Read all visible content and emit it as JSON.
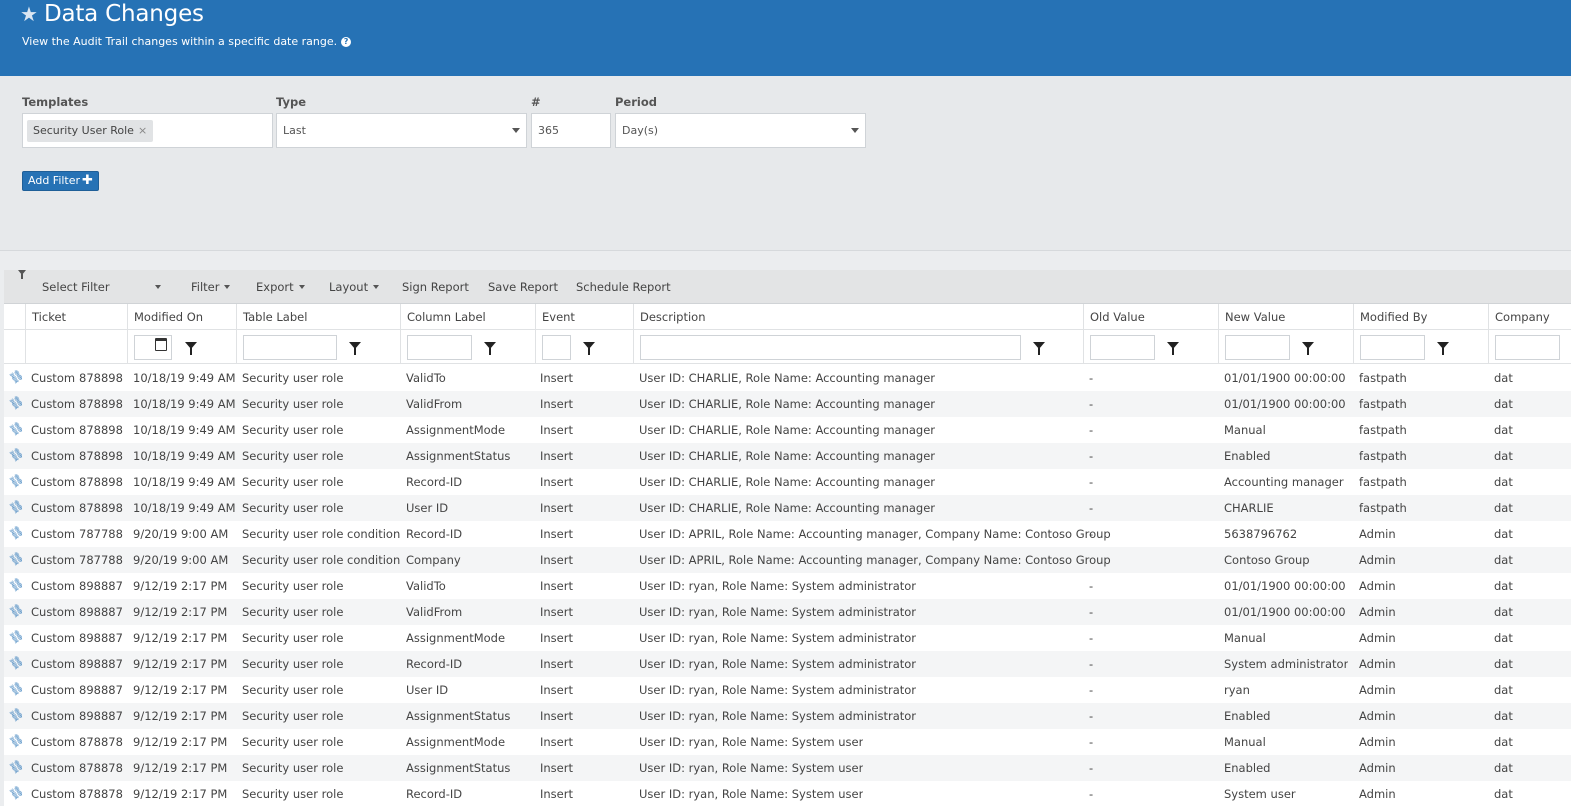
{
  "header": {
    "title": "Data Changes",
    "subtitle": "View the Audit Trail changes within a specific date range.",
    "colors": {
      "brand": "#2672b5"
    }
  },
  "filters": {
    "templates_label": "Templates",
    "templates_chip": "Security User Role",
    "type_label": "Type",
    "type_value": "Last",
    "number_label": "#",
    "number_value": "365",
    "period_label": "Period",
    "period_value": "Day(s)",
    "add_filter_label": "Add Filter"
  },
  "toolbar": {
    "select_filter": "Select Filter",
    "filter": "Filter",
    "export": "Export",
    "layout": "Layout",
    "sign_report": "Sign Report",
    "save_report": "Save Report",
    "schedule_report": "Schedule Report"
  },
  "columns": [
    "Ticket",
    "Modified On",
    "Table Label",
    "Column Label",
    "Event",
    "Description",
    "Old Value",
    "New Value",
    "Modified By",
    "Company"
  ],
  "rows": [
    {
      "ticket_type": "Custom",
      "ticket_no": "878898",
      "modified_on": "10/18/19 9:49 AM",
      "table_label": "Security user role",
      "column_label": "ValidTo",
      "event": "Insert",
      "description": "User ID: CHARLIE, Role Name: Accounting manager",
      "old_value": "-",
      "new_value": "01/01/1900 00:00:00",
      "modified_by": "fastpath",
      "company": "dat"
    },
    {
      "ticket_type": "Custom",
      "ticket_no": "878898",
      "modified_on": "10/18/19 9:49 AM",
      "table_label": "Security user role",
      "column_label": "ValidFrom",
      "event": "Insert",
      "description": "User ID: CHARLIE, Role Name: Accounting manager",
      "old_value": "-",
      "new_value": "01/01/1900 00:00:00",
      "modified_by": "fastpath",
      "company": "dat"
    },
    {
      "ticket_type": "Custom",
      "ticket_no": "878898",
      "modified_on": "10/18/19 9:49 AM",
      "table_label": "Security user role",
      "column_label": "AssignmentMode",
      "event": "Insert",
      "description": "User ID: CHARLIE, Role Name: Accounting manager",
      "old_value": "-",
      "new_value": "Manual",
      "modified_by": "fastpath",
      "company": "dat"
    },
    {
      "ticket_type": "Custom",
      "ticket_no": "878898",
      "modified_on": "10/18/19 9:49 AM",
      "table_label": "Security user role",
      "column_label": "AssignmentStatus",
      "event": "Insert",
      "description": "User ID: CHARLIE, Role Name: Accounting manager",
      "old_value": "-",
      "new_value": "Enabled",
      "modified_by": "fastpath",
      "company": "dat"
    },
    {
      "ticket_type": "Custom",
      "ticket_no": "878898",
      "modified_on": "10/18/19 9:49 AM",
      "table_label": "Security user role",
      "column_label": "Record-ID",
      "event": "Insert",
      "description": "User ID: CHARLIE, Role Name: Accounting manager",
      "old_value": "-",
      "new_value": "Accounting manager",
      "modified_by": "fastpath",
      "company": "dat"
    },
    {
      "ticket_type": "Custom",
      "ticket_no": "878898",
      "modified_on": "10/18/19 9:49 AM",
      "table_label": "Security user role",
      "column_label": "User ID",
      "event": "Insert",
      "description": "User ID: CHARLIE, Role Name: Accounting manager",
      "old_value": "-",
      "new_value": "CHARLIE",
      "modified_by": "fastpath",
      "company": "dat"
    },
    {
      "ticket_type": "Custom",
      "ticket_no": "787788",
      "modified_on": "9/20/19 9:00 AM",
      "table_label": "Security user role condition",
      "column_label": "Record-ID",
      "event": "Insert",
      "description": "User ID: APRIL, Role Name: Accounting manager, Company Name: Contoso Group",
      "old_value": "-",
      "new_value": "5638796762",
      "modified_by": "Admin",
      "company": "dat"
    },
    {
      "ticket_type": "Custom",
      "ticket_no": "787788",
      "modified_on": "9/20/19 9:00 AM",
      "table_label": "Security user role condition",
      "column_label": "Company",
      "event": "Insert",
      "description": "User ID: APRIL, Role Name: Accounting manager, Company Name: Contoso Group",
      "old_value": "",
      "new_value": "Contoso Group",
      "modified_by": "Admin",
      "company": "dat"
    },
    {
      "ticket_type": "Custom",
      "ticket_no": "898887",
      "modified_on": "9/12/19 2:17 PM",
      "table_label": "Security user role",
      "column_label": "ValidTo",
      "event": "Insert",
      "description": "User ID: ryan, Role Name: System administrator",
      "old_value": "-",
      "new_value": "01/01/1900 00:00:00",
      "modified_by": "Admin",
      "company": "dat"
    },
    {
      "ticket_type": "Custom",
      "ticket_no": "898887",
      "modified_on": "9/12/19 2:17 PM",
      "table_label": "Security user role",
      "column_label": "ValidFrom",
      "event": "Insert",
      "description": "User ID: ryan, Role Name: System administrator",
      "old_value": "-",
      "new_value": "01/01/1900 00:00:00",
      "modified_by": "Admin",
      "company": "dat"
    },
    {
      "ticket_type": "Custom",
      "ticket_no": "898887",
      "modified_on": "9/12/19 2:17 PM",
      "table_label": "Security user role",
      "column_label": "AssignmentMode",
      "event": "Insert",
      "description": "User ID: ryan, Role Name: System administrator",
      "old_value": "-",
      "new_value": "Manual",
      "modified_by": "Admin",
      "company": "dat"
    },
    {
      "ticket_type": "Custom",
      "ticket_no": "898887",
      "modified_on": "9/12/19 2:17 PM",
      "table_label": "Security user role",
      "column_label": "Record-ID",
      "event": "Insert",
      "description": "User ID: ryan, Role Name: System administrator",
      "old_value": "-",
      "new_value": "System administrator",
      "modified_by": "Admin",
      "company": "dat"
    },
    {
      "ticket_type": "Custom",
      "ticket_no": "898887",
      "modified_on": "9/12/19 2:17 PM",
      "table_label": "Security user role",
      "column_label": "User ID",
      "event": "Insert",
      "description": "User ID: ryan, Role Name: System administrator",
      "old_value": "-",
      "new_value": "ryan",
      "modified_by": "Admin",
      "company": "dat"
    },
    {
      "ticket_type": "Custom",
      "ticket_no": "898887",
      "modified_on": "9/12/19 2:17 PM",
      "table_label": "Security user role",
      "column_label": "AssignmentStatus",
      "event": "Insert",
      "description": "User ID: ryan, Role Name: System administrator",
      "old_value": "-",
      "new_value": "Enabled",
      "modified_by": "Admin",
      "company": "dat"
    },
    {
      "ticket_type": "Custom",
      "ticket_no": "878878",
      "modified_on": "9/12/19 2:17 PM",
      "table_label": "Security user role",
      "column_label": "AssignmentMode",
      "event": "Insert",
      "description": "User ID: ryan, Role Name: System user",
      "old_value": "-",
      "new_value": "Manual",
      "modified_by": "Admin",
      "company": "dat"
    },
    {
      "ticket_type": "Custom",
      "ticket_no": "878878",
      "modified_on": "9/12/19 2:17 PM",
      "table_label": "Security user role",
      "column_label": "AssignmentStatus",
      "event": "Insert",
      "description": "User ID: ryan, Role Name: System user",
      "old_value": "-",
      "new_value": "Enabled",
      "modified_by": "Admin",
      "company": "dat"
    },
    {
      "ticket_type": "Custom",
      "ticket_no": "878878",
      "modified_on": "9/12/19 2:17 PM",
      "table_label": "Security user role",
      "column_label": "Record-ID",
      "event": "Insert",
      "description": "User ID: ryan, Role Name: System user",
      "old_value": "-",
      "new_value": "System user",
      "modified_by": "Admin",
      "company": "dat"
    }
  ]
}
